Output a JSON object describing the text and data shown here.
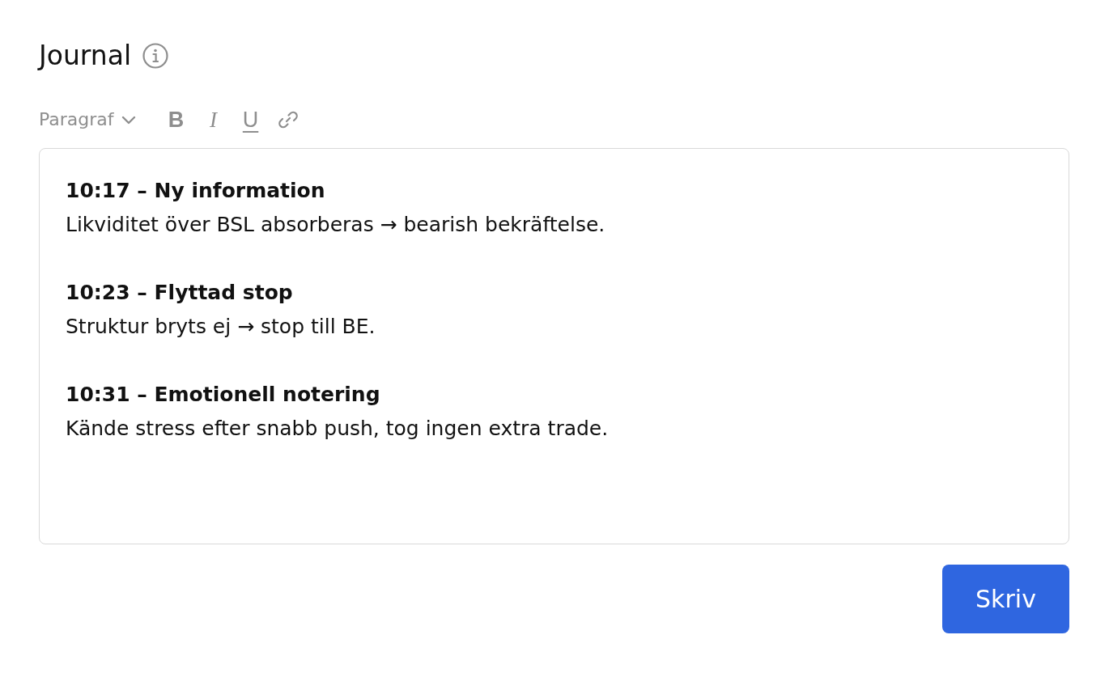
{
  "header": {
    "title": "Journal"
  },
  "toolbar": {
    "block_format": "Paragraf",
    "format_buttons": [
      {
        "kind": "bold",
        "label": "B"
      },
      {
        "kind": "italic",
        "label": "I"
      },
      {
        "kind": "underline",
        "label": "U"
      },
      {
        "kind": "link"
      }
    ]
  },
  "editor": {
    "entries": [
      {
        "heading": "10:17 – Ny information",
        "body": "Likviditet över BSL absorberas → bearish bekräftelse."
      },
      {
        "heading": "10:23 – Flyttad stop",
        "body": "Struktur bryts ej → stop till BE."
      },
      {
        "heading": "10:31 – Emotionell notering",
        "body": "Kände stress efter snabb push, tog ingen extra trade."
      }
    ]
  },
  "submit_button": {
    "label": "Skriv"
  }
}
